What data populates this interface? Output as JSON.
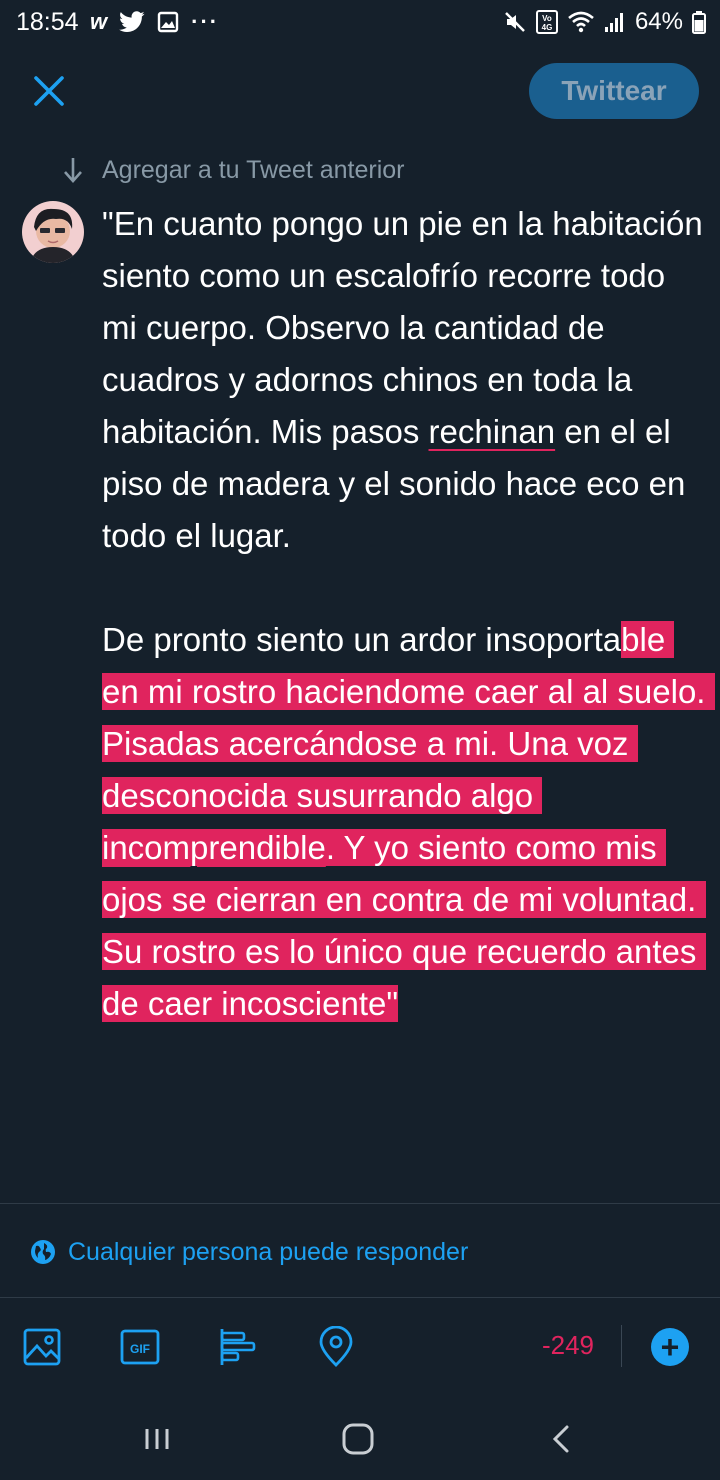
{
  "status_bar": {
    "time": "18:54",
    "battery_percent": "64%",
    "left_icons": [
      "wattpad-icon",
      "twitter-icon",
      "gallery-icon",
      "more-icon"
    ],
    "right_icons": [
      "mute-icon",
      "volte-icon",
      "wifi-icon",
      "signal-icon",
      "battery-icon"
    ]
  },
  "header": {
    "close_icon": "close-icon",
    "tweet_button_label": "Twittear"
  },
  "thread": {
    "add_previous_label": "Agregar a tu Tweet anterior"
  },
  "tweet": {
    "p1_part1": "\"En cuanto pongo un pie en la habitación siento como un escalofrío recorre todo mi cuerpo. Observo la cantidad de cuadros y adornos chinos en toda la habitación. Mis pasos ",
    "p1_misspelled": "rechinan",
    "p1_part2": " en el el piso de madera y el sonido hace eco en todo el lugar.",
    "p2_plain": "De pronto siento un ardor insoporta",
    "p2_highlight1": "ble en mi rostro haciendome caer al al suelo. Pisadas acercándose a mi. Una voz desconocida susurrando algo ",
    "p2_misspelled": "incomprendible",
    "p2_highlight2": ". Y yo siento como mis ojos se cierran en contra de mi voluntad. Su rostro es lo único que recuerdo antes de caer incosciente\""
  },
  "reply_setting": {
    "label": "Cualquier persona puede responder",
    "icon": "globe-icon"
  },
  "toolbar": {
    "icons": [
      "image-icon",
      "gif-icon",
      "poll-icon",
      "location-icon"
    ],
    "gif_label": "GIF",
    "char_counter": "-249",
    "add_label": "+"
  },
  "colors": {
    "background": "#15202b",
    "accent": "#1da1f2",
    "highlight": "#e0245e",
    "muted_text": "#8899a6",
    "tweet_button_bg": "#1a5f8f"
  },
  "nav_bar": {
    "buttons": [
      "recents-icon",
      "home-icon",
      "back-icon"
    ]
  }
}
